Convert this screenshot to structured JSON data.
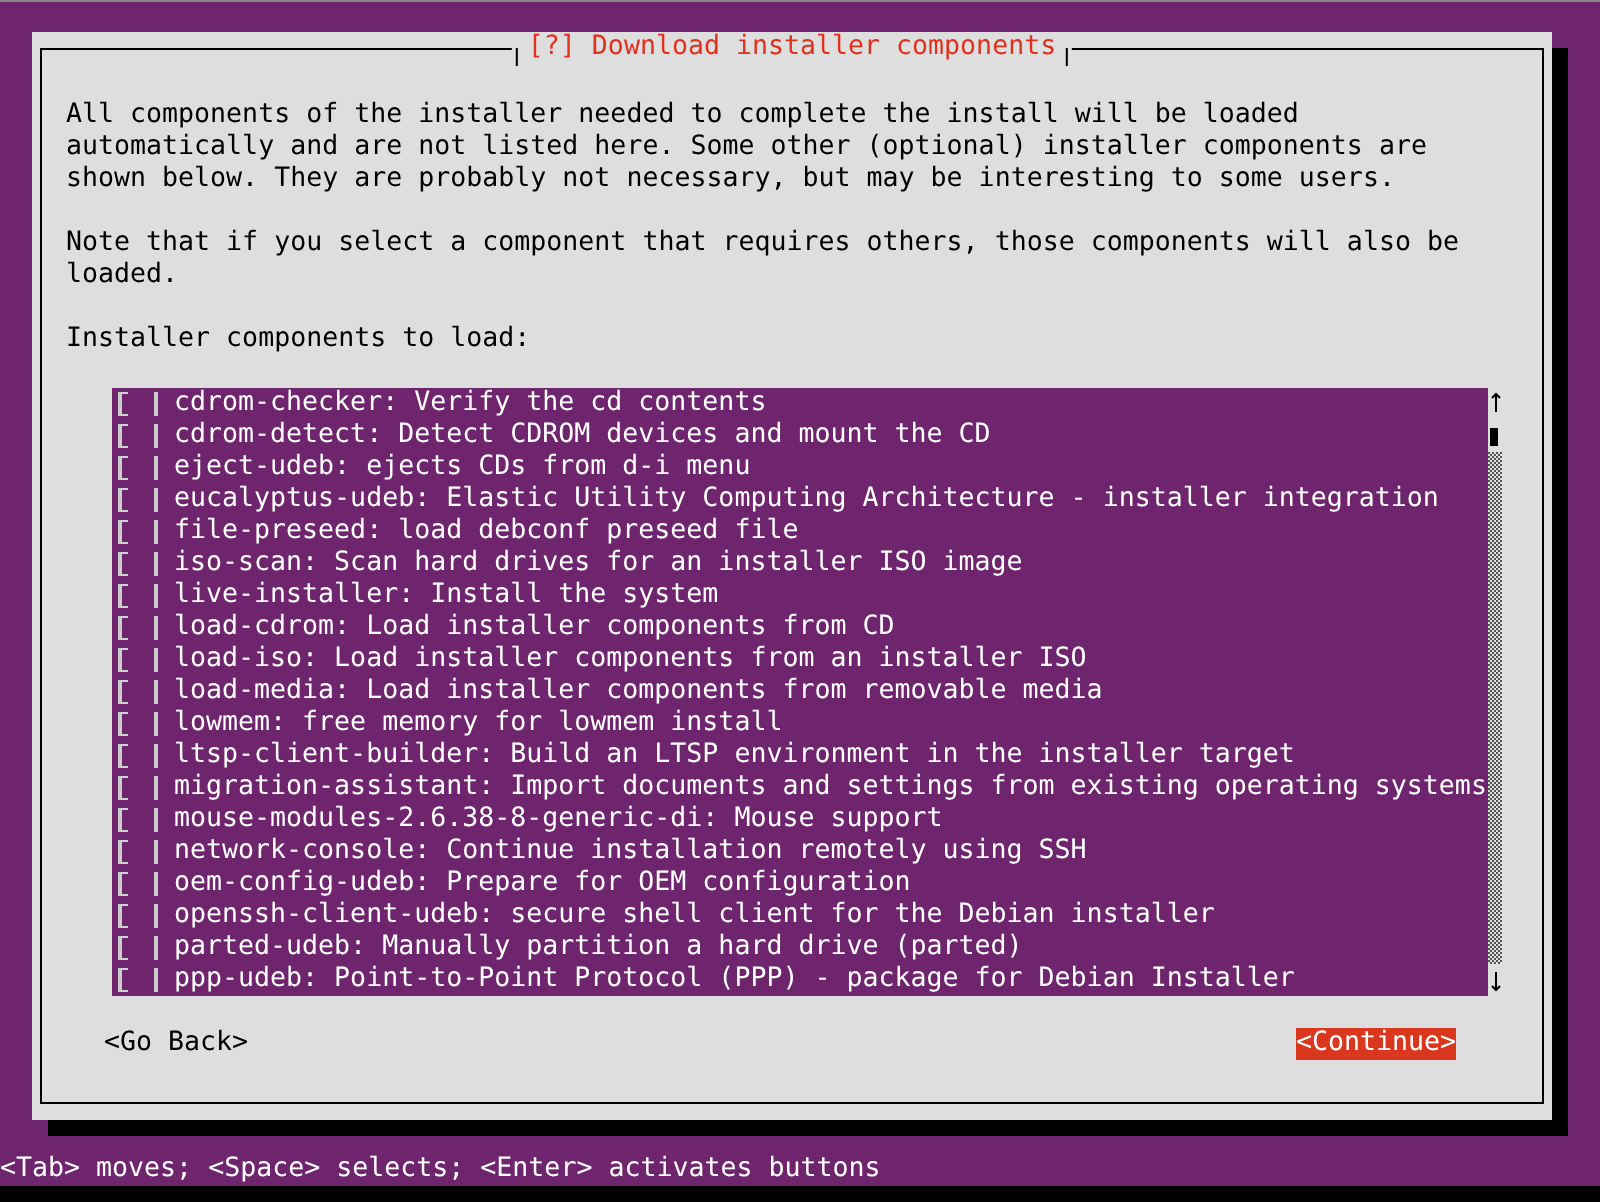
{
  "dialog": {
    "title": "[?] Download installer components",
    "paragraphs": [
      "All components of the installer needed to complete the install will be loaded automatically and are not listed here. Some other (optional) installer components are shown below. They are probably not necessary, but may be interesting to some users.",
      "Note that if you select a component that requires others, those components will also be loaded."
    ],
    "list_label": "Installer components to load:",
    "components": [
      {
        "label": "cdrom-checker: Verify the cd contents",
        "checked": false
      },
      {
        "label": "cdrom-detect: Detect CDROM devices and mount the CD",
        "checked": false
      },
      {
        "label": "eject-udeb: ejects CDs from d-i menu",
        "checked": false
      },
      {
        "label": "eucalyptus-udeb: Elastic Utility Computing Architecture - installer integration",
        "checked": false
      },
      {
        "label": "file-preseed: load debconf preseed file",
        "checked": false
      },
      {
        "label": "iso-scan: Scan hard drives for an installer ISO image",
        "checked": false
      },
      {
        "label": "live-installer: Install the system",
        "checked": false
      },
      {
        "label": "load-cdrom: Load installer components from CD",
        "checked": false
      },
      {
        "label": "load-iso: Load installer components from an installer ISO",
        "checked": false
      },
      {
        "label": "load-media: Load installer components from removable media",
        "checked": false
      },
      {
        "label": "lowmem: free memory for lowmem install",
        "checked": false
      },
      {
        "label": "ltsp-client-builder: Build an LTSP environment in the installer target",
        "checked": false
      },
      {
        "label": "migration-assistant: Import documents and settings from existing operating systems",
        "checked": false
      },
      {
        "label": "mouse-modules-2.6.38-8-generic-di: Mouse support",
        "checked": false
      },
      {
        "label": "network-console: Continue installation remotely using SSH",
        "checked": false
      },
      {
        "label": "oem-config-udeb: Prepare for OEM configuration",
        "checked": false
      },
      {
        "label": "openssh-client-udeb: secure shell client for the Debian installer",
        "checked": false
      },
      {
        "label": "parted-udeb: Manually partition a hard drive (parted)",
        "checked": false
      },
      {
        "label": "ppp-udeb: Point-to-Point Protocol (PPP) - package for Debian Installer",
        "checked": false
      }
    ],
    "buttons": [
      {
        "label": "<Go Back>",
        "selected": false
      },
      {
        "label": "<Continue>",
        "selected": true
      }
    ]
  },
  "status_bar": "<Tab> moves; <Space> selects; <Enter> activates buttons"
}
